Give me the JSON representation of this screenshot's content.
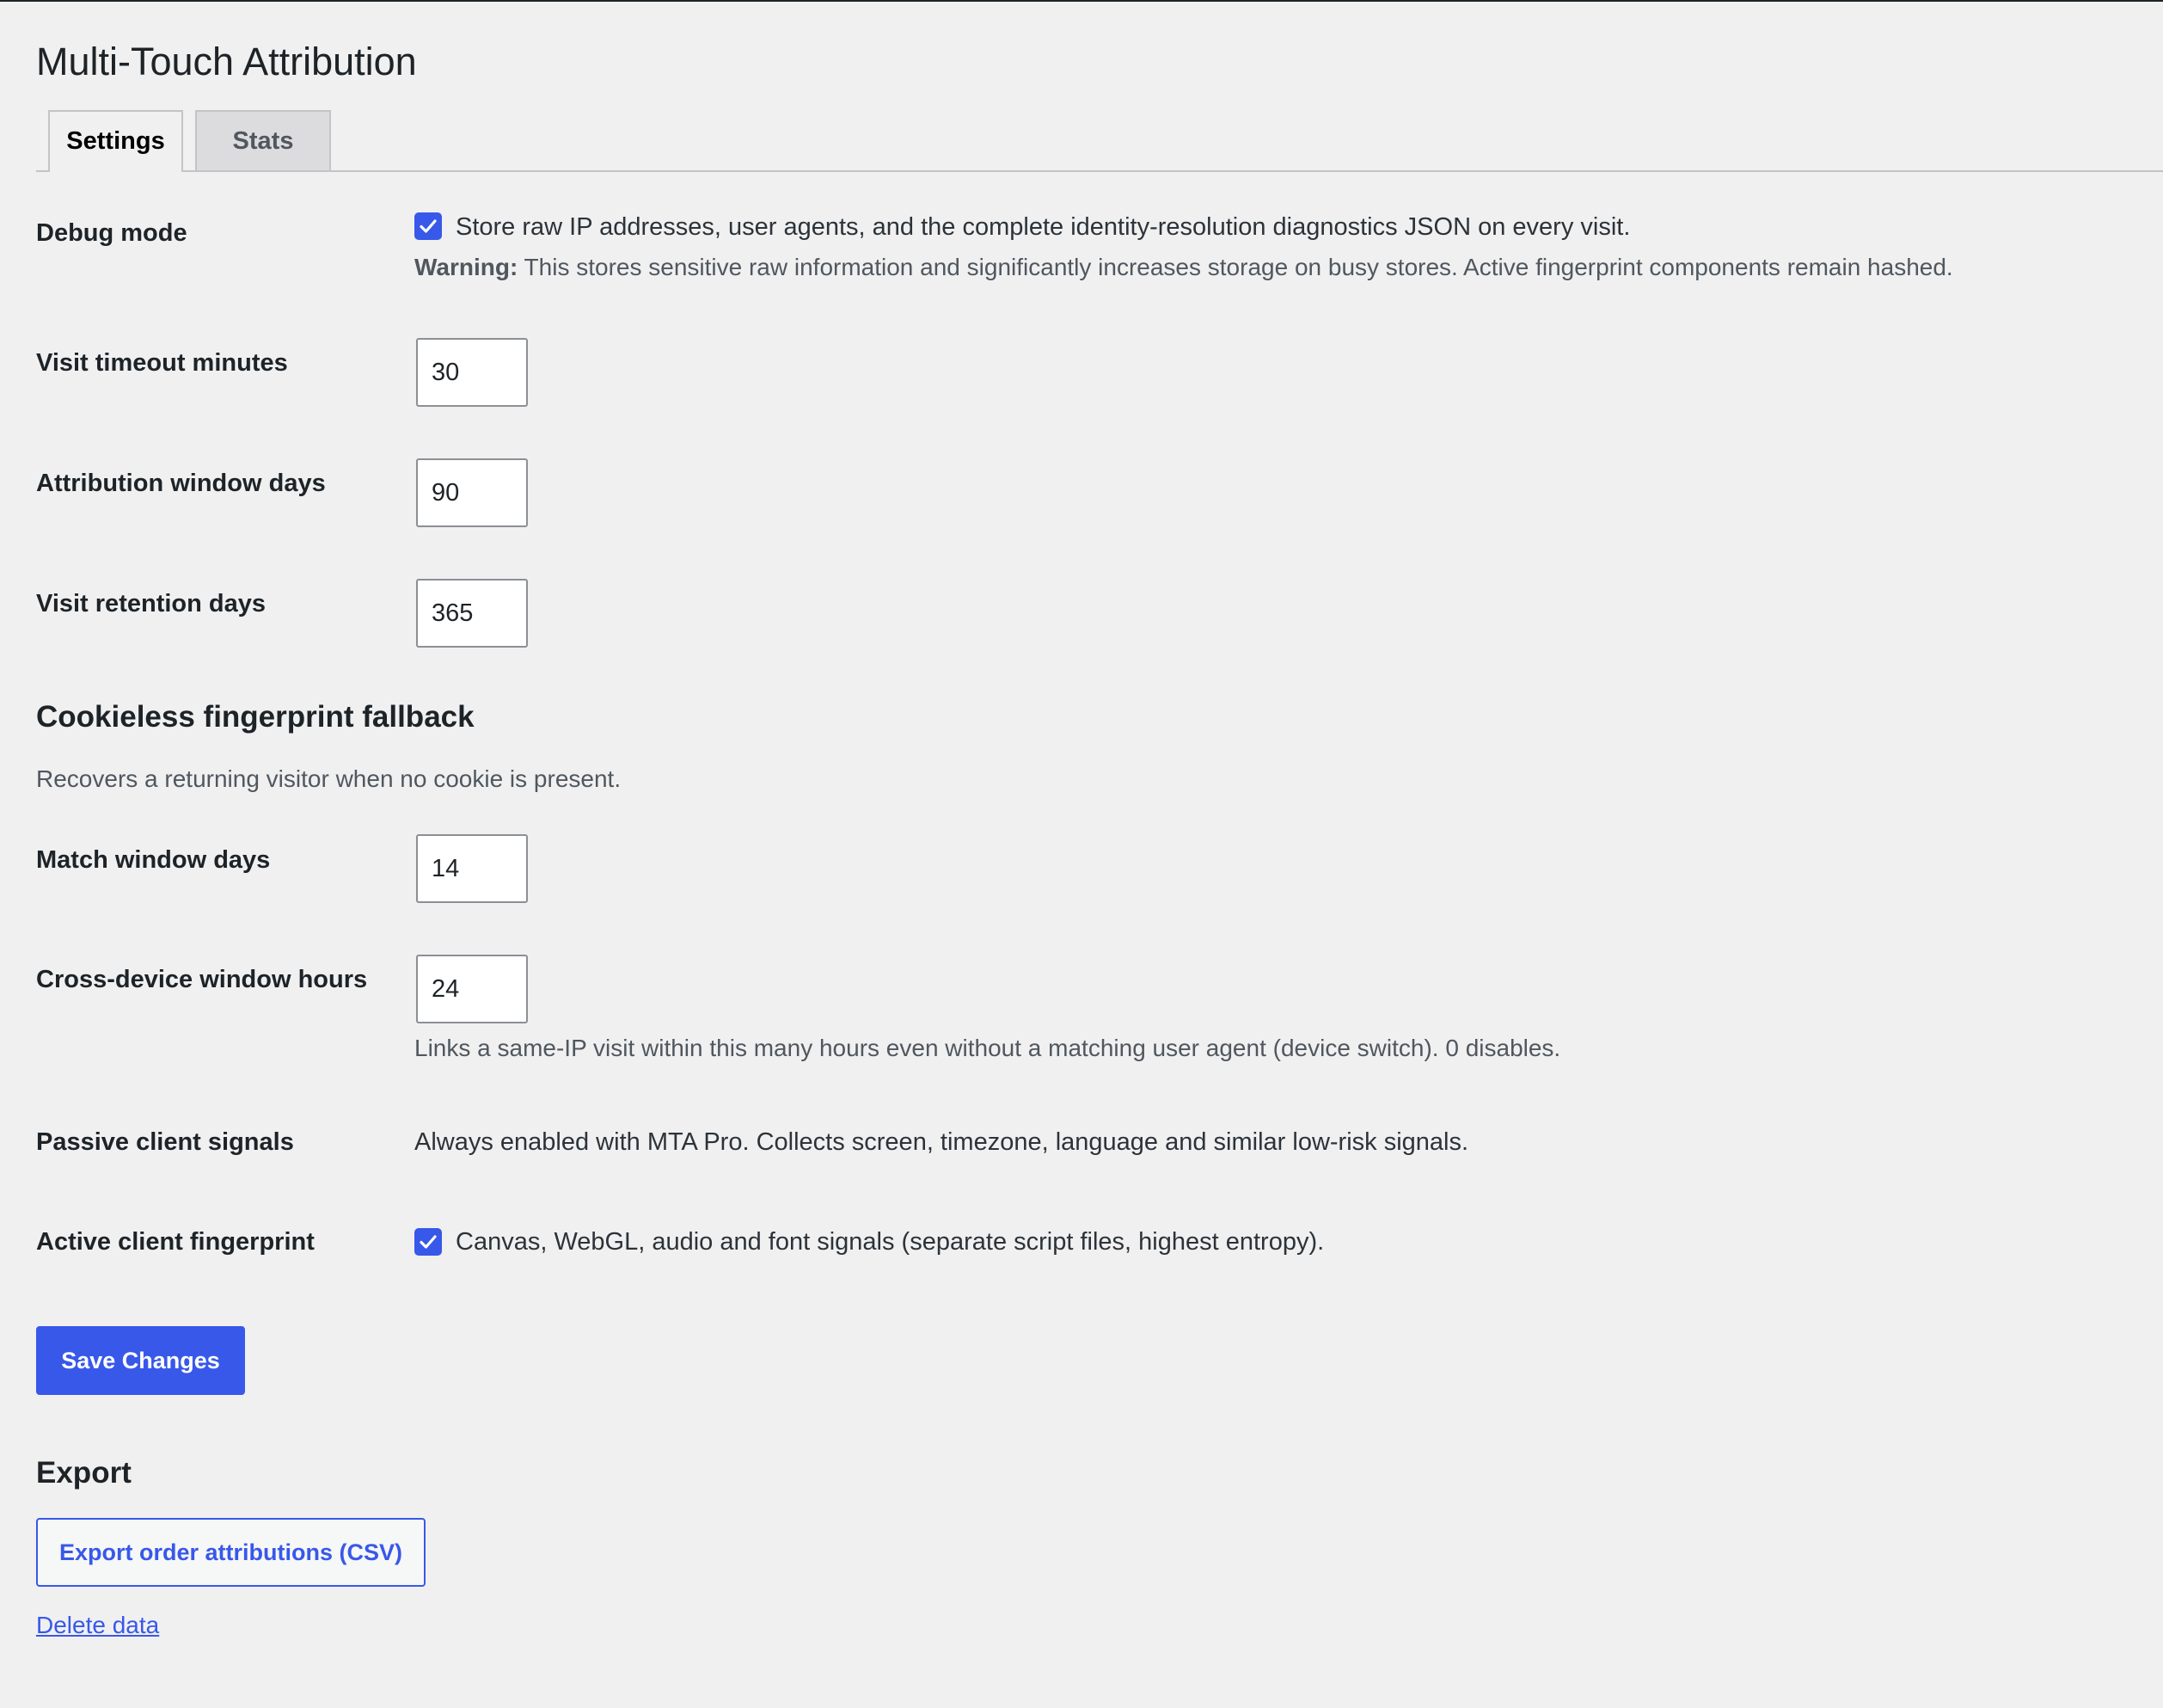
{
  "page": {
    "title": "Multi-Touch Attribution"
  },
  "tabs": [
    {
      "label": "Settings",
      "active": true
    },
    {
      "label": "Stats",
      "active": false
    }
  ],
  "settings": {
    "debug_mode": {
      "label": "Debug mode",
      "checked": true,
      "checkbox_text": "Store raw IP addresses, user agents, and the complete identity-resolution diagnostics JSON on every visit.",
      "warning_label": "Warning:",
      "warning_text": " This stores sensitive raw information and significantly increases storage on busy stores. Active fingerprint components remain hashed."
    },
    "visit_timeout": {
      "label": "Visit timeout minutes",
      "value": "30"
    },
    "attribution_window": {
      "label": "Attribution window days",
      "value": "90"
    },
    "visit_retention": {
      "label": "Visit retention days",
      "value": "365"
    }
  },
  "fingerprint_section": {
    "title": "Cookieless fingerprint fallback",
    "description": "Recovers a returning visitor when no cookie is present.",
    "match_window": {
      "label": "Match window days",
      "value": "14"
    },
    "cross_device_window": {
      "label": "Cross-device window hours",
      "value": "24",
      "description": "Links a same-IP visit within this many hours even without a matching user agent (device switch). 0 disables."
    },
    "passive_signals": {
      "label": "Passive client signals",
      "text": "Always enabled with MTA Pro. Collects screen, timezone, language and similar low-risk signals."
    },
    "active_fingerprint": {
      "label": "Active client fingerprint",
      "checked": true,
      "checkbox_text": "Canvas, WebGL, audio and font signals (separate script files, highest entropy)."
    }
  },
  "actions": {
    "save_label": "Save Changes"
  },
  "export_section": {
    "title": "Export",
    "export_button_label": "Export order attributions (CSV)",
    "delete_link_label": "Delete data"
  },
  "colors": {
    "accent": "#3858e9",
    "background": "#f0f0f1",
    "text": "#1d2327",
    "muted_text": "#50575e"
  }
}
